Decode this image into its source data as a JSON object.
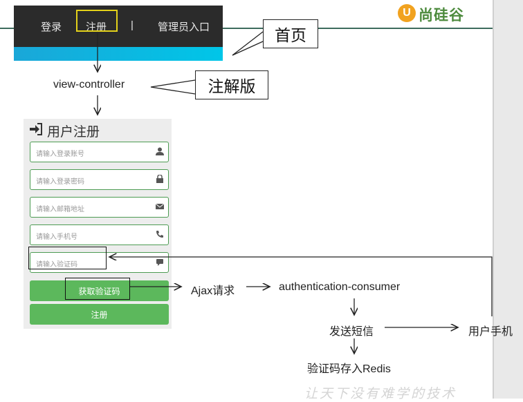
{
  "nav": {
    "login": "登录",
    "register": "注册",
    "separator": "|",
    "admin": "管理员入口"
  },
  "brand": {
    "logo_letter": "U",
    "name": "尚硅谷"
  },
  "callouts": {
    "home": "首页",
    "annotation": "注解版"
  },
  "flow": {
    "view_controller": "view-controller",
    "ajax": "Ajax请求",
    "consumer": "authentication-consumer",
    "send_sms": "发送短信",
    "user_phone": "用户手机",
    "redis": "验证码存入Redis"
  },
  "form": {
    "title": "用户注册",
    "fields": [
      {
        "placeholder": "请输入登录账号",
        "icon": "user-icon"
      },
      {
        "placeholder": "请输入登录密码",
        "icon": "lock-icon"
      },
      {
        "placeholder": "请输入邮箱地址",
        "icon": "envelope-icon"
      },
      {
        "placeholder": "请输入手机号",
        "icon": "phone-icon"
      },
      {
        "placeholder": "请输入验证码",
        "icon": "comment-icon"
      }
    ],
    "get_code_button": "获取验证码",
    "register_button": "注册"
  },
  "watermark": "让天下没有难学的技术",
  "colors": {
    "nav_bg": "#2b2b2b",
    "accent_cyan": "#1aa7d8",
    "button_green": "#5cb85c",
    "highlight_yellow": "#e4d21a",
    "brand_green": "#4c8a3c"
  }
}
